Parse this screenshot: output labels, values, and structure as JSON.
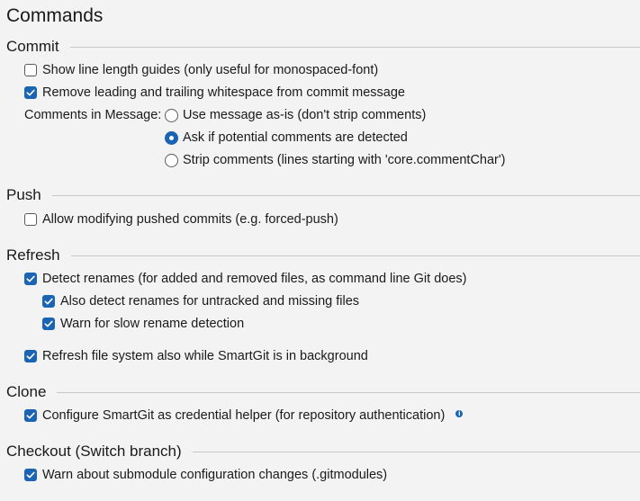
{
  "title": "Commands",
  "groups": {
    "commit": {
      "label": "Commit",
      "show_line_length_guides": {
        "label": "Show line length guides (only useful for monospaced-font)",
        "checked": false
      },
      "remove_whitespace": {
        "label": "Remove leading and trailing whitespace from commit message",
        "checked": true
      },
      "comments_label": "Comments in Message:",
      "comment_options": [
        {
          "label": "Use message as-is (don't strip comments)",
          "selected": false
        },
        {
          "label": "Ask if potential comments are detected",
          "selected": true
        },
        {
          "label": "Strip comments (lines starting with 'core.commentChar')",
          "selected": false
        }
      ]
    },
    "push": {
      "label": "Push",
      "allow_modifying_pushed": {
        "label": "Allow modifying pushed commits (e.g. forced-push)",
        "checked": false
      }
    },
    "refresh": {
      "label": "Refresh",
      "detect_renames": {
        "label": "Detect renames (for added and removed files, as command line Git does)",
        "checked": true
      },
      "detect_renames_untracked": {
        "label": "Also detect renames for untracked and missing files",
        "checked": true
      },
      "warn_slow_rename": {
        "label": "Warn for slow rename detection",
        "checked": true
      },
      "refresh_background": {
        "label": "Refresh file system also while SmartGit is in background",
        "checked": true
      }
    },
    "clone": {
      "label": "Clone",
      "credential_helper": {
        "label": "Configure SmartGit as credential helper (for repository authentication)",
        "checked": true,
        "icon": "info-icon"
      }
    },
    "checkout": {
      "label": "Checkout (Switch branch)",
      "warn_submodule": {
        "label": "Warn about submodule configuration changes (.gitmodules)",
        "checked": true
      }
    }
  },
  "colors": {
    "accent": "#1a64b4",
    "background": "#f3f3f3",
    "separator": "#c8c8c8"
  }
}
